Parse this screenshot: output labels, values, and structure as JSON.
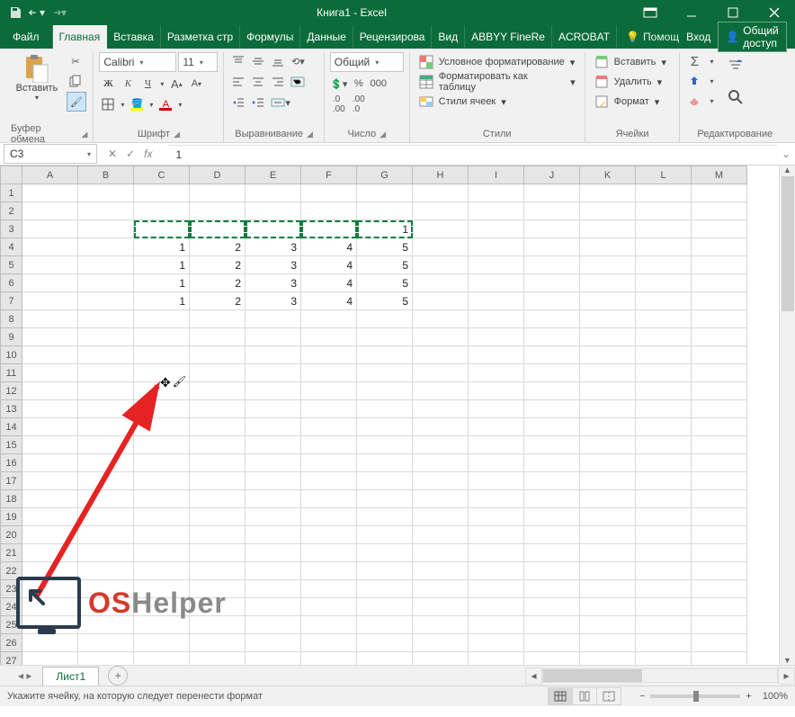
{
  "title": "Книга1 - Excel",
  "qat": {
    "save": "save",
    "undo": "undo",
    "redo": "redo"
  },
  "winbtns": {
    "ribbonOpts": "ribbon-display-options",
    "min": "minimize",
    "max": "maximize",
    "close": "close"
  },
  "tabs": {
    "file": "Файл",
    "home": "Главная",
    "insert": "Вставка",
    "layout": "Разметка стр",
    "formulas": "Формулы",
    "data": "Данные",
    "review": "Рецензирова",
    "view": "Вид",
    "abbyy": "ABBYY FineRe",
    "acrobat": "ACROBAT"
  },
  "tellme": "Помощ",
  "signin": "Вход",
  "share": "Общий доступ",
  "groups": {
    "clipboard": {
      "label": "Буфер обмена",
      "paste": "Вставить",
      "cut": "cut",
      "copy": "copy",
      "painter": "format-painter"
    },
    "font": {
      "label": "Шрифт",
      "name": "Calibri",
      "size": "11",
      "bold": "Ж",
      "italic": "К",
      "underline": "Ч",
      "increase": "A",
      "decrease": "A"
    },
    "align": {
      "label": "Выравнивание"
    },
    "number": {
      "label": "Число",
      "format": "Общий",
      "currency": "₽",
      "percent": "%",
      "thousands": "000",
      "incDec": "increase-decimal",
      "decDec": "decrease-decimal"
    },
    "styles": {
      "label": "Стили",
      "cond": "Условное форматирование",
      "table": "Форматировать как таблицу",
      "cell": "Стили ячеек"
    },
    "cells": {
      "label": "Ячейки",
      "insert": "Вставить",
      "delete": "Удалить",
      "format": "Формат"
    },
    "editing": {
      "label": "Редактирование",
      "sum": "Σ",
      "fill": "fill",
      "clear": "clear",
      "sort": "sort-filter",
      "find": "find-select"
    }
  },
  "namebox": "C3",
  "formula": "1",
  "columns": [
    "A",
    "B",
    "C",
    "D",
    "E",
    "F",
    "G",
    "H",
    "I",
    "J",
    "K",
    "L",
    "M"
  ],
  "rows": 27,
  "cells": {
    "3": {
      "G": "1"
    },
    "4": {
      "C": "1",
      "D": "2",
      "E": "3",
      "F": "4",
      "G": "5"
    },
    "5": {
      "C": "1",
      "D": "2",
      "E": "3",
      "F": "4",
      "G": "5"
    },
    "6": {
      "C": "1",
      "D": "2",
      "E": "3",
      "F": "4",
      "G": "5"
    },
    "7": {
      "C": "1",
      "D": "2",
      "E": "3",
      "F": "4",
      "G": "5"
    }
  },
  "selection": {
    "marchingRow": 3,
    "from": "C",
    "to": "G"
  },
  "sheet": {
    "name": "Лист1"
  },
  "status": "Укажите ячейку, на которую следует перенести формат",
  "zoom": "100%",
  "watermark": {
    "os": "OS",
    "helper": "Helper"
  }
}
